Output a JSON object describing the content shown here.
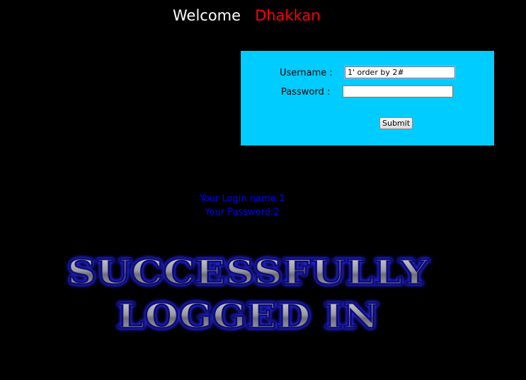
{
  "header": {
    "welcome": "Welcome",
    "name": "Dhakkan"
  },
  "form": {
    "username_label": "Username :",
    "username_value": "1' order by 2#",
    "password_label": "Password :",
    "password_value": "",
    "submit_label": "Submit"
  },
  "result": {
    "login_name": "Your Login name:1",
    "password": "Your Password:2"
  },
  "banner": {
    "line1": "SUCCESSFULLY",
    "line2": "LOGGED IN"
  },
  "colors": {
    "background": "#000000",
    "form_background": "#00ccff",
    "welcome_text": "#ffffff",
    "name_text": "#ff0000",
    "result_text": "#0000ff",
    "banner_glow": "#1f1fff"
  }
}
